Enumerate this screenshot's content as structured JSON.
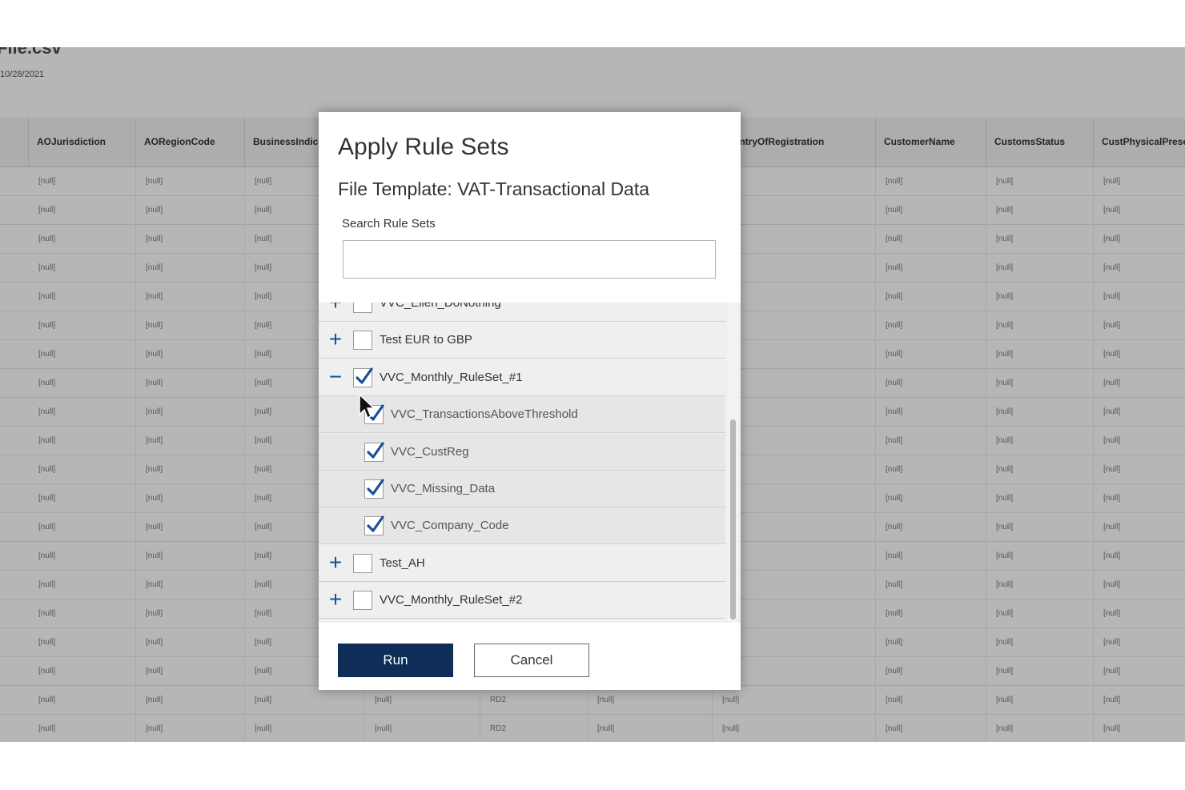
{
  "background": {
    "file_title": "File.csv",
    "file_date": "10/28/2021",
    "columns": [
      "",
      "AOJurisdiction",
      "AORegionCode",
      "BusinessIndica",
      "",
      "",
      "",
      "CountryOfRegistration",
      "CustomerName",
      "CustomsStatus",
      "CustPhysicalPrese"
    ],
    "null_text": "[null]",
    "row_count": 20,
    "last_rows_extra": [
      "[null]",
      "RD2",
      "[null]",
      "[null]"
    ]
  },
  "dialog": {
    "title": "Apply Rule Sets",
    "subtitle": "File Template: VAT-Transactional Data",
    "search_label": "Search Rule Sets",
    "search_value": "",
    "items": [
      {
        "expander": "+",
        "checked": false,
        "label": "VVC_Ellen_DoNothing",
        "child": false
      },
      {
        "expander": "+",
        "checked": false,
        "label": "Test EUR to GBP",
        "child": false
      },
      {
        "expander": "−",
        "checked": true,
        "label": "VVC_Monthly_RuleSet_#1",
        "child": false
      },
      {
        "expander": "",
        "checked": true,
        "label": "VVC_TransactionsAboveThreshold",
        "child": true
      },
      {
        "expander": "",
        "checked": true,
        "label": "VVC_CustReg",
        "child": true
      },
      {
        "expander": "",
        "checked": true,
        "label": "VVC_Missing_Data",
        "child": true
      },
      {
        "expander": "",
        "checked": true,
        "label": "VVC_Company_Code",
        "child": true
      },
      {
        "expander": "+",
        "checked": false,
        "label": "Test_AH",
        "child": false
      },
      {
        "expander": "+",
        "checked": false,
        "label": "VVC_Monthly_RuleSet_#2",
        "child": false
      }
    ],
    "run_label": "Run",
    "cancel_label": "Cancel"
  },
  "colors": {
    "primary": "#0e2d57",
    "check": "#1a4f96",
    "overlay": "#d4d4d4"
  }
}
